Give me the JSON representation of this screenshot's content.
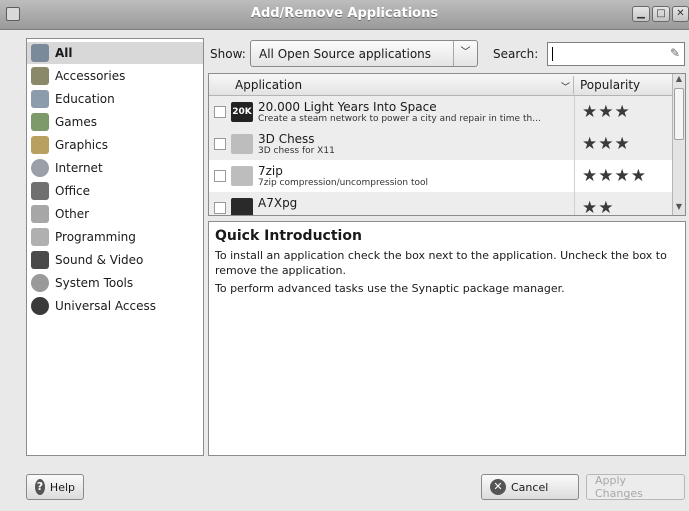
{
  "window": {
    "title": "Add/Remove Applications"
  },
  "categories": [
    {
      "label": "All",
      "icon": "refresh-icon",
      "selected": true
    },
    {
      "label": "Accessories",
      "icon": "accessories-icon"
    },
    {
      "label": "Education",
      "icon": "education-icon"
    },
    {
      "label": "Games",
      "icon": "games-icon"
    },
    {
      "label": "Graphics",
      "icon": "graphics-icon"
    },
    {
      "label": "Internet",
      "icon": "internet-icon"
    },
    {
      "label": "Office",
      "icon": "office-icon"
    },
    {
      "label": "Other",
      "icon": "other-icon"
    },
    {
      "label": "Programming",
      "icon": "programming-icon"
    },
    {
      "label": "Sound & Video",
      "icon": "sound-video-icon"
    },
    {
      "label": "System Tools",
      "icon": "system-tools-icon"
    },
    {
      "label": "Universal Access",
      "icon": "accessibility-icon"
    }
  ],
  "filter": {
    "show_label": "Show:",
    "show_value": "All Open Source applications",
    "search_label": "Search:",
    "search_value": ""
  },
  "list": {
    "columns": [
      "Application",
      "Popularity"
    ],
    "rows": [
      {
        "name": "20.000 Light Years Into Space",
        "desc": "Create a steam network to power a city and repair in time th…",
        "stars": "★★★",
        "checked": false
      },
      {
        "name": "3D Chess",
        "desc": "3D chess for X11",
        "stars": "★★★",
        "checked": false
      },
      {
        "name": "7zip",
        "desc": "7zip compression/uncompression tool",
        "stars": "★★★★",
        "checked": false
      },
      {
        "name": "A7Xpg",
        "desc": "",
        "stars": "★★",
        "checked": false
      }
    ]
  },
  "info": {
    "title": "Quick Introduction",
    "p1": "To install an application check the box next to the application. Uncheck the box to remove the application.",
    "p2": "To perform advanced tasks use the Synaptic package manager."
  },
  "buttons": {
    "help": "Help",
    "cancel": "Cancel",
    "apply": "Apply Changes"
  }
}
